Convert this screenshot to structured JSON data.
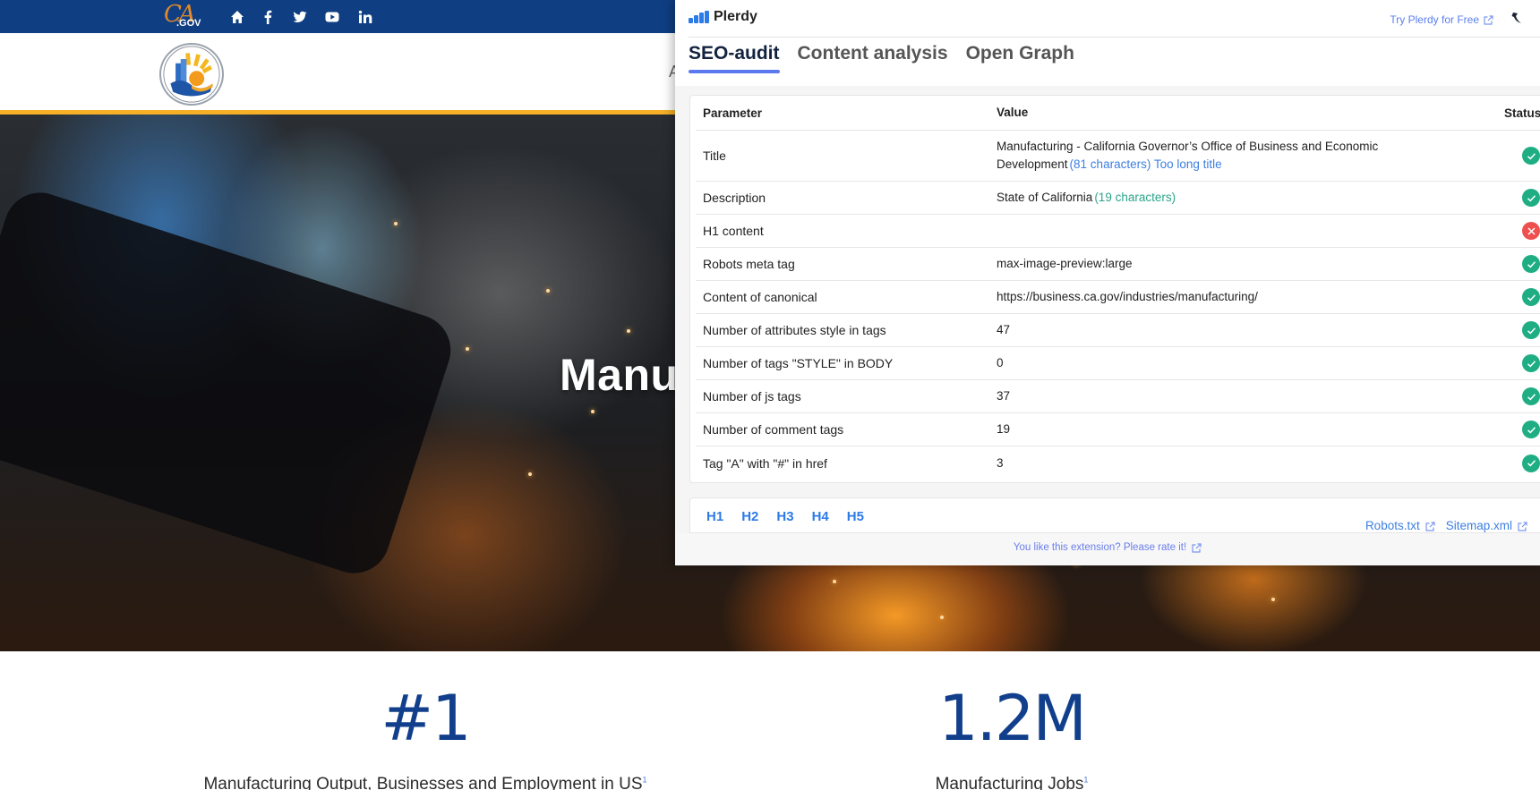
{
  "site": {
    "topbar": {
      "logo_text_ca": "CA",
      "logo_text_gov": ".GOV",
      "social_icons": [
        "home-icon",
        "facebook-icon",
        "twitter-icon",
        "youtube-icon",
        "linkedin-icon"
      ]
    },
    "header": {
      "agency_logo_alt": "California Governor's Office of Business and Economic Development",
      "nav_hint": "A"
    },
    "hero": {
      "title": "Manu"
    },
    "stats": [
      {
        "value": "#1",
        "label": "Manufacturing Output, Businesses and Employment in US",
        "footnote": "1"
      },
      {
        "value": "1.2M",
        "label": "Manufacturing Jobs",
        "footnote": "1"
      }
    ],
    "colors": {
      "topbar": "#0f3e83",
      "stripe": "#f5b027",
      "stat_value": "#123f8c"
    }
  },
  "plerdy": {
    "brand": "Plerdy",
    "try_link": "Try Plerdy for Free",
    "tabs": [
      {
        "label": "SEO-audit",
        "active": true
      },
      {
        "label": "Content analysis",
        "active": false
      },
      {
        "label": "Open Graph",
        "active": false
      }
    ],
    "table": {
      "headers": {
        "parameter": "Parameter",
        "value": "Value",
        "status": "Status"
      },
      "rows": [
        {
          "parameter": "Title",
          "value": "Manufacturing - California Governor’s Office of Business and Economic Development",
          "hint": "(81 characters) Too long title",
          "hint_color": "blue",
          "status": "ok"
        },
        {
          "parameter": "Description",
          "value": "State of California",
          "hint": "(19 characters)",
          "hint_color": "green",
          "status": "ok"
        },
        {
          "parameter": "H1 content",
          "value": "",
          "hint": "",
          "status": "fail"
        },
        {
          "parameter": "Robots meta tag",
          "value": "max-image-preview:large",
          "hint": "",
          "status": "ok"
        },
        {
          "parameter": "Content of canonical",
          "value": "https://business.ca.gov/industries/manufacturing/",
          "hint": "",
          "status": "ok"
        },
        {
          "parameter": "Number of attributes style in tags",
          "value": "47",
          "hint": "",
          "status": "ok"
        },
        {
          "parameter": "Number of tags \"STYLE\" in BODY",
          "value": "0",
          "hint": "",
          "status": "ok"
        },
        {
          "parameter": "Number of js tags",
          "value": "37",
          "hint": "",
          "status": "ok"
        },
        {
          "parameter": "Number of comment tags",
          "value": "19",
          "hint": "",
          "status": "ok"
        },
        {
          "parameter": "Tag \"A\" with \"#\" in href",
          "value": "3",
          "hint": "",
          "status": "ok"
        }
      ]
    },
    "heading_tabs": [
      "H1",
      "H2",
      "H3",
      "H4",
      "H5"
    ],
    "footer_links": [
      "Robots.txt",
      "Sitemap.xml"
    ],
    "rate_text": "You like this extension? Please rate it!",
    "colors": {
      "accent": "#5b79ef",
      "link": "#3d7fe0",
      "ok": "#1fae84",
      "fail": "#ee5050"
    }
  }
}
